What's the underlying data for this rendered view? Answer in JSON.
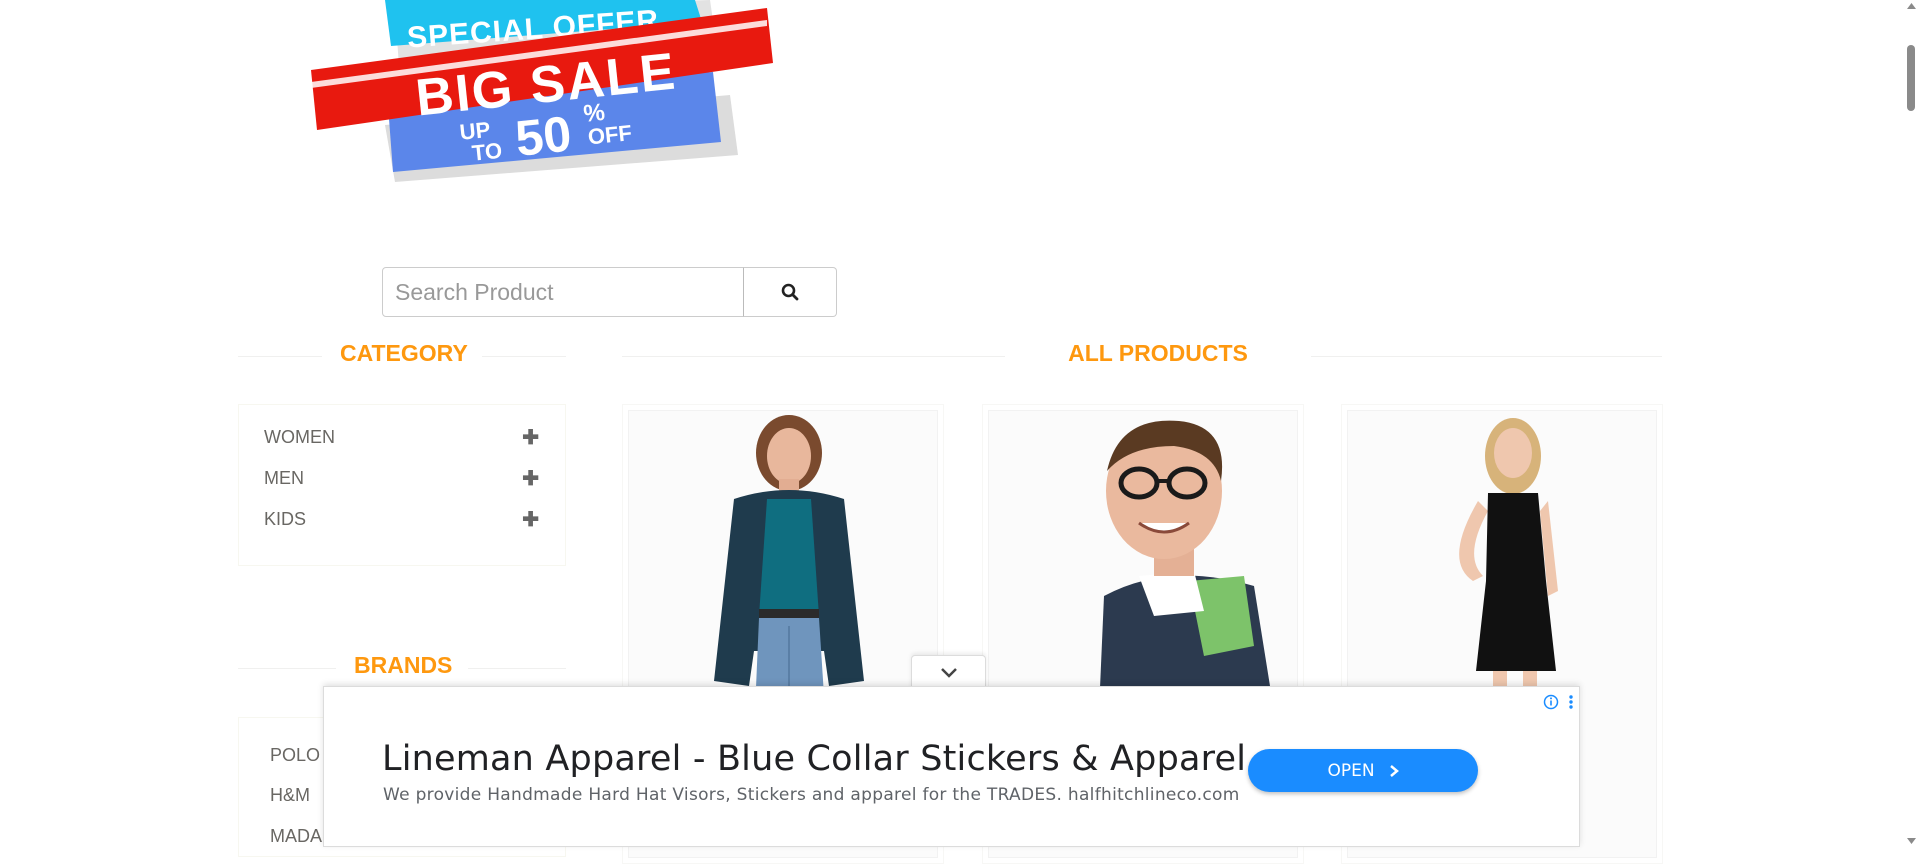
{
  "banner": {
    "line1": "SPECIAL OFFER",
    "line2": "BIG SALE",
    "line3_prefix_top": "UP",
    "line3_prefix_bottom": "TO",
    "line3_number": "50",
    "line3_percent": "%",
    "line3_suffix": "OFF"
  },
  "search": {
    "placeholder": "Search Product",
    "icon": "search-icon"
  },
  "sidebar": {
    "category_title": "CATEGORY",
    "categories": [
      {
        "label": "WOMEN",
        "icon": "plus-icon"
      },
      {
        "label": "MEN",
        "icon": "plus-icon"
      },
      {
        "label": "KIDS",
        "icon": "plus-icon"
      }
    ],
    "brands_title": "BRANDS",
    "brands": [
      {
        "label": "POLO"
      },
      {
        "label": "H&M"
      },
      {
        "label": "MADAME"
      }
    ]
  },
  "main": {
    "title": "ALL PRODUCTS",
    "products": [
      {
        "image": "woman-casual-photo"
      },
      {
        "image": "man-glasses-photo"
      },
      {
        "image": "woman-black-dress-photo"
      }
    ]
  },
  "ad": {
    "title": "Lineman Apparel - Blue Collar Stickers & Apparel",
    "description": "We provide Handmade Hard Hat Visors, Stickers and apparel for the TRADES. halfhitchlineco.com",
    "open_label": "OPEN",
    "info_icon": "info-icon",
    "menu_icon": "kebab-menu-icon",
    "collapse_icon": "chevron-down-icon",
    "button_color": "#1a8cff"
  },
  "colors": {
    "accent": "#FE980F",
    "banner_red": "#e8190f",
    "banner_cyan": "#1fc2ef",
    "banner_blue": "#5b86ea"
  }
}
